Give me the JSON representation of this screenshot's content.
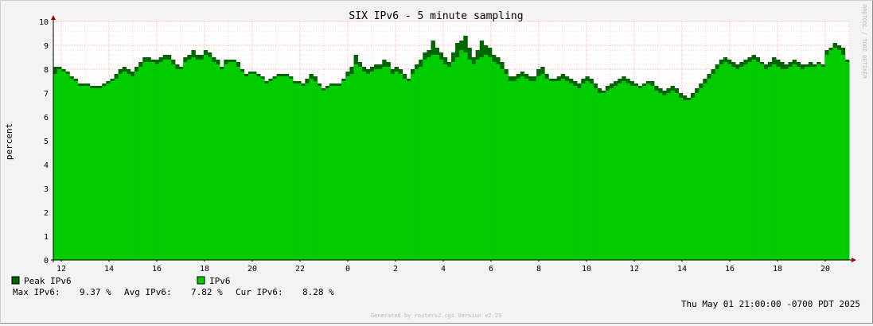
{
  "chart_data": {
    "type": "area",
    "title": "SIX IPv6 - 5 minute sampling",
    "ylabel": "percent",
    "ylim": [
      0,
      10
    ],
    "yticks": [
      0,
      1,
      2,
      3,
      4,
      5,
      6,
      7,
      8,
      9,
      10
    ],
    "xtick_labels": [
      "12",
      "14",
      "16",
      "18",
      "20",
      "22",
      "0",
      "2",
      "4",
      "6",
      "8",
      "10",
      "12",
      "14",
      "16",
      "18",
      "20"
    ],
    "grid": true,
    "colors": {
      "avg": "#00cc00",
      "peak": "#006600",
      "axis_arrow": "#990000",
      "grid": "#ffaaaa"
    },
    "series": [
      {
        "name": "IPv6",
        "values": [
          7.8,
          8.0,
          7.9,
          7.8,
          7.6,
          7.5,
          7.3,
          7.3,
          7.3,
          7.2,
          7.2,
          7.2,
          7.3,
          7.4,
          7.5,
          7.6,
          7.8,
          7.9,
          7.8,
          7.7,
          7.9,
          8.1,
          8.3,
          8.3,
          8.3,
          8.2,
          8.3,
          8.4,
          8.4,
          8.2,
          8.0,
          8.0,
          8.3,
          8.4,
          8.5,
          8.4,
          8.4,
          8.6,
          8.5,
          8.3,
          8.2,
          8.0,
          8.2,
          8.3,
          8.3,
          8.1,
          7.9,
          7.7,
          7.8,
          7.8,
          7.7,
          7.6,
          7.4,
          7.5,
          7.6,
          7.7,
          7.7,
          7.7,
          7.6,
          7.4,
          7.4,
          7.3,
          7.4,
          7.6,
          7.5,
          7.3,
          7.1,
          7.2,
          7.3,
          7.3,
          7.3,
          7.5,
          7.7,
          7.8,
          8.2,
          8.1,
          7.9,
          7.8,
          7.9,
          8.0,
          8.0,
          8.1,
          8.1,
          7.8,
          7.9,
          7.8,
          7.6,
          7.5,
          7.8,
          8.0,
          8.1,
          8.4,
          8.5,
          8.6,
          8.6,
          8.4,
          8.2,
          8.1,
          8.3,
          8.5,
          8.8,
          8.7,
          8.4,
          8.2,
          8.4,
          8.5,
          8.6,
          8.5,
          8.3,
          8.2,
          8.0,
          7.8,
          7.5,
          7.5,
          7.6,
          7.7,
          7.6,
          7.5,
          7.5,
          7.7,
          7.8,
          7.6,
          7.5,
          7.5,
          7.5,
          7.6,
          7.5,
          7.4,
          7.3,
          7.2,
          7.4,
          7.5,
          7.4,
          7.2,
          7.0,
          7.0,
          7.1,
          7.2,
          7.3,
          7.4,
          7.5,
          7.4,
          7.3,
          7.3,
          7.2,
          7.3,
          7.4,
          7.3,
          7.1,
          7.0,
          6.9,
          7.0,
          7.1,
          7.0,
          6.8,
          6.7,
          6.7,
          6.8,
          7.0,
          7.2,
          7.4,
          7.6,
          7.8,
          8.0,
          8.2,
          8.3,
          8.2,
          8.1,
          8.0,
          8.1,
          8.2,
          8.3,
          8.4,
          8.3,
          8.2,
          8.0,
          8.1,
          8.2,
          8.1,
          8.0,
          8.0,
          8.1,
          8.2,
          8.1,
          8.0,
          8.1,
          8.1,
          8.1,
          8.2,
          8.1,
          8.6,
          8.8,
          8.9,
          8.8,
          8.6,
          8.3
        ],
        "color": "#00cc00"
      },
      {
        "name": "Peak IPv6",
        "values": [
          8.1,
          8.1,
          8.0,
          7.9,
          7.7,
          7.6,
          7.4,
          7.4,
          7.4,
          7.3,
          7.3,
          7.3,
          7.4,
          7.5,
          7.6,
          7.8,
          8.0,
          8.1,
          8.0,
          7.9,
          8.1,
          8.3,
          8.5,
          8.5,
          8.4,
          8.4,
          8.5,
          8.6,
          8.6,
          8.4,
          8.2,
          8.1,
          8.5,
          8.6,
          8.8,
          8.6,
          8.6,
          8.8,
          8.7,
          8.5,
          8.4,
          8.1,
          8.4,
          8.4,
          8.4,
          8.3,
          8.0,
          7.8,
          7.9,
          7.9,
          7.8,
          7.7,
          7.5,
          7.6,
          7.7,
          7.8,
          7.8,
          7.8,
          7.7,
          7.5,
          7.5,
          7.4,
          7.6,
          7.8,
          7.7,
          7.4,
          7.2,
          7.3,
          7.4,
          7.4,
          7.4,
          7.6,
          7.9,
          8.1,
          8.6,
          8.3,
          8.1,
          8.0,
          8.1,
          8.2,
          8.2,
          8.4,
          8.3,
          8.0,
          8.1,
          8.0,
          7.8,
          7.6,
          8.0,
          8.2,
          8.4,
          8.7,
          8.8,
          9.2,
          8.9,
          8.7,
          8.5,
          8.3,
          8.7,
          9.1,
          9.2,
          9.4,
          8.9,
          8.5,
          8.8,
          9.2,
          9.0,
          8.9,
          8.6,
          8.5,
          8.3,
          8.0,
          7.7,
          7.7,
          7.8,
          7.9,
          7.8,
          7.7,
          7.7,
          8.0,
          8.1,
          7.8,
          7.6,
          7.6,
          7.7,
          7.8,
          7.7,
          7.6,
          7.5,
          7.4,
          7.6,
          7.7,
          7.6,
          7.4,
          7.2,
          7.1,
          7.3,
          7.4,
          7.5,
          7.6,
          7.7,
          7.6,
          7.5,
          7.4,
          7.3,
          7.4,
          7.5,
          7.5,
          7.3,
          7.2,
          7.1,
          7.2,
          7.3,
          7.2,
          7.0,
          6.9,
          6.8,
          7.0,
          7.2,
          7.4,
          7.6,
          7.8,
          8.0,
          8.2,
          8.4,
          8.5,
          8.4,
          8.3,
          8.2,
          8.3,
          8.4,
          8.5,
          8.6,
          8.5,
          8.3,
          8.2,
          8.3,
          8.5,
          8.4,
          8.3,
          8.2,
          8.3,
          8.4,
          8.3,
          8.2,
          8.2,
          8.3,
          8.2,
          8.3,
          8.2,
          8.8,
          8.9,
          9.1,
          9.0,
          8.9,
          8.4
        ],
        "color": "#006600"
      }
    ],
    "legend": [
      {
        "label": "Peak IPv6",
        "color": "#006600"
      },
      {
        "label": "IPv6",
        "color": "#00cc00"
      }
    ],
    "stats": {
      "max_label": "Max IPv6:",
      "max_value": "9.37 %",
      "avg_label": "Avg IPv6:",
      "avg_value": "7.82 %",
      "cur_label": "Cur IPv6:",
      "cur_value": "8.28 %"
    },
    "timestamp": "Thu May 01 21:00:00 -0700 PDT 2025",
    "vertical_label": "RRDTOOL / TOBI OETIKER",
    "footer": "Generated by routers2.cgi Version v2.23"
  }
}
